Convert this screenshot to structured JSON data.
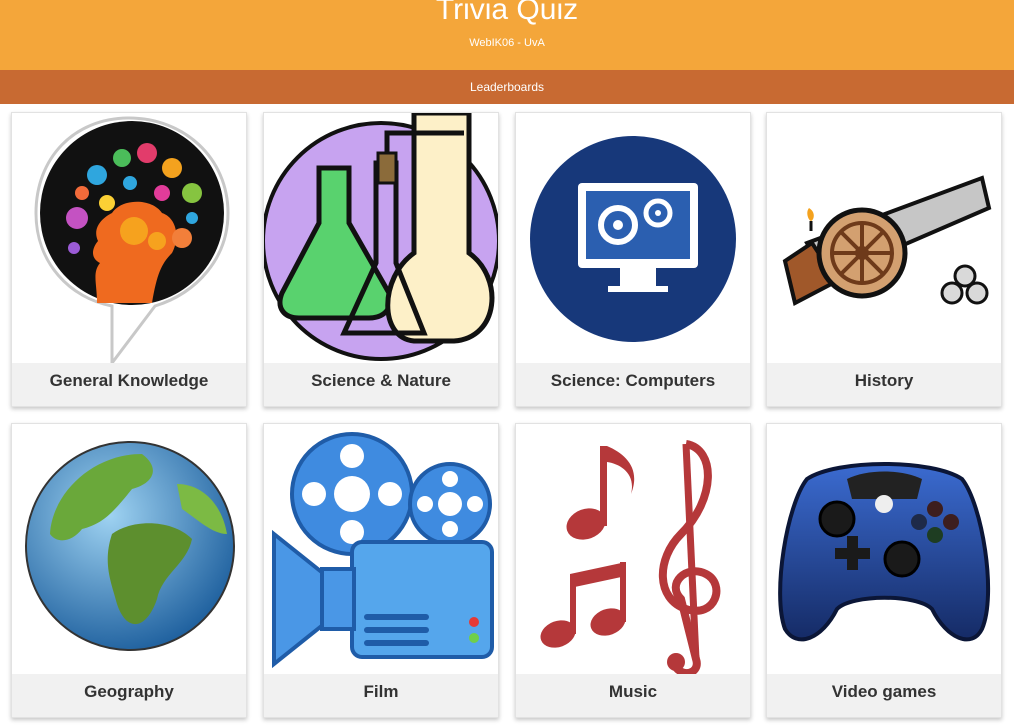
{
  "header": {
    "title": "Trivia Quiz",
    "subtitle": "WebIK06 - UvA"
  },
  "nav": {
    "leaderboards": "Leaderboards"
  },
  "categories": [
    {
      "label": "General Knowledge",
      "icon": "alexa-brain-icon"
    },
    {
      "label": "Science & Nature",
      "icon": "lab-flasks-icon"
    },
    {
      "label": "Science: Computers",
      "icon": "computer-gears-icon"
    },
    {
      "label": "History",
      "icon": "cannon-icon"
    },
    {
      "label": "Geography",
      "icon": "globe-icon"
    },
    {
      "label": "Film",
      "icon": "film-projector-icon"
    },
    {
      "label": "Music",
      "icon": "music-notes-icon"
    },
    {
      "label": "Video games",
      "icon": "game-controller-icon"
    }
  ],
  "colors": {
    "header": "#f4a63a",
    "navbar": "#c86a32",
    "label_bg": "#f1f1f1"
  }
}
